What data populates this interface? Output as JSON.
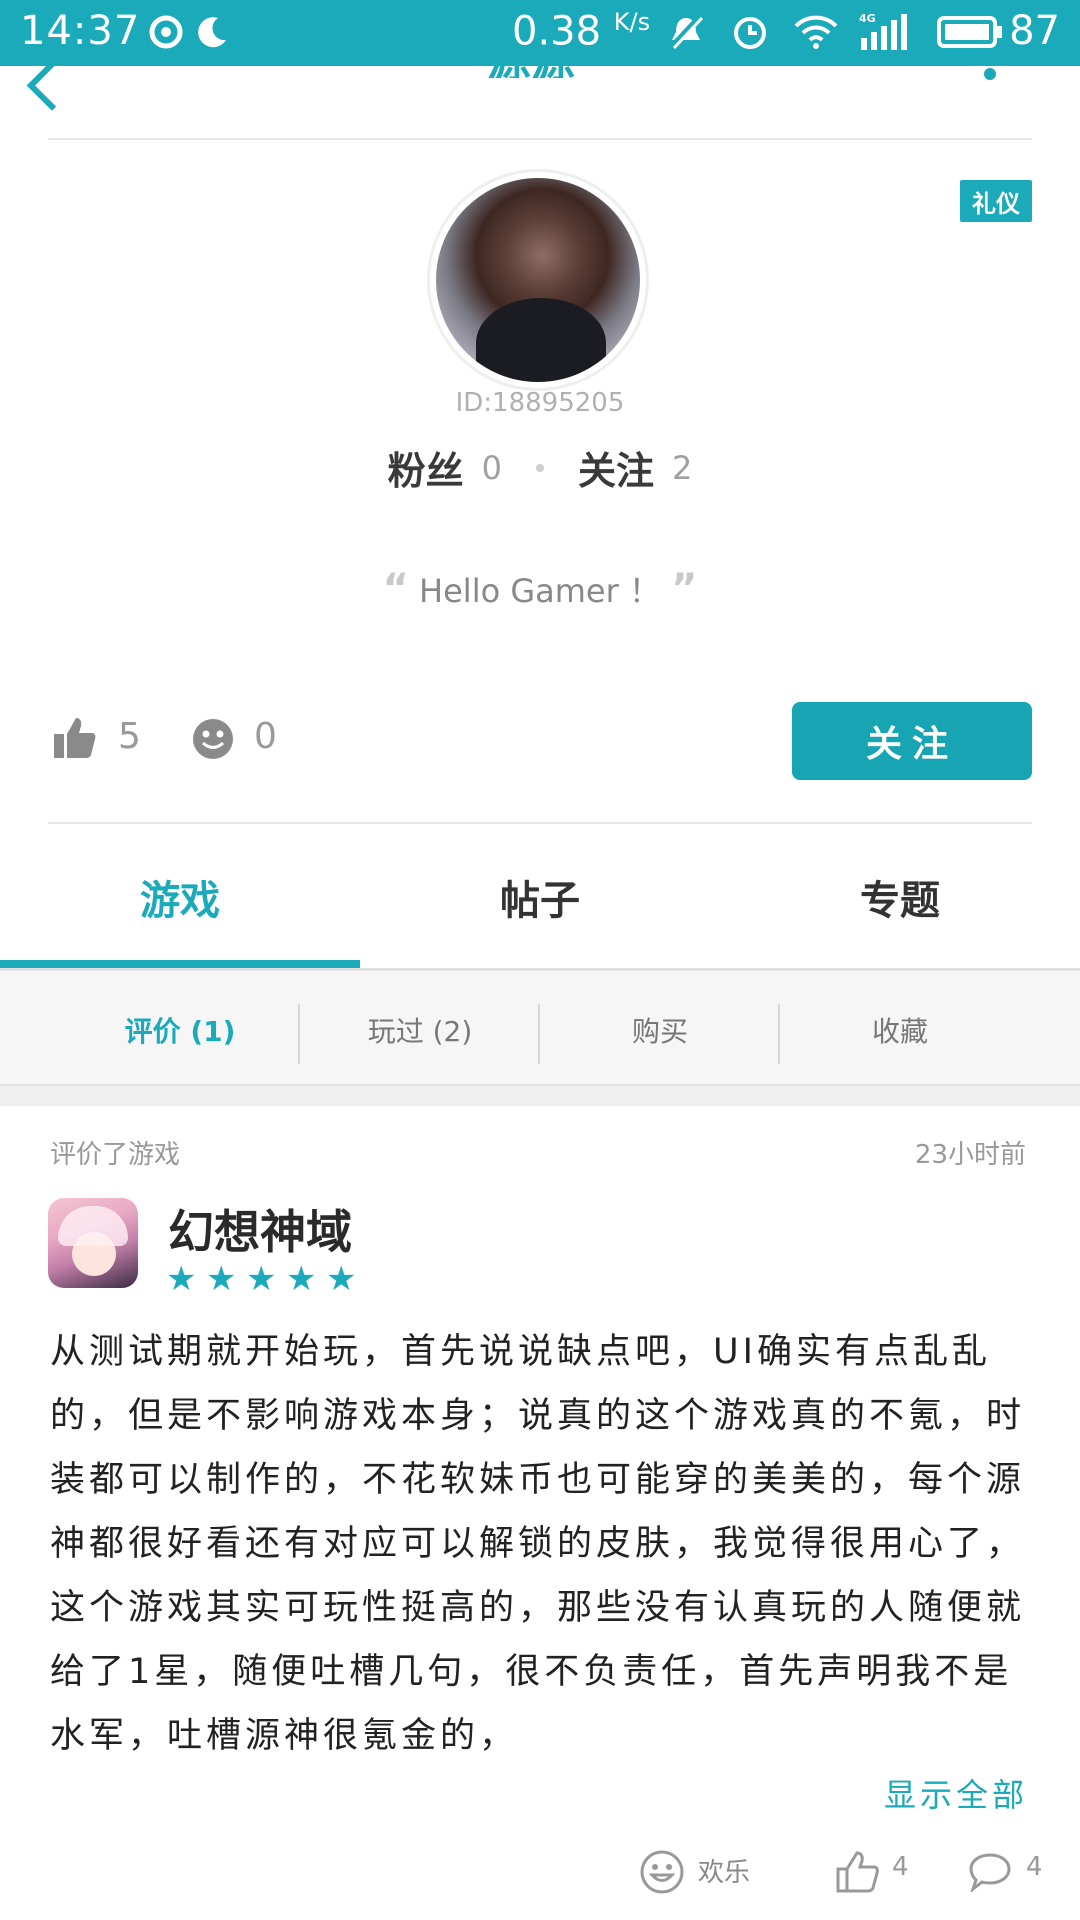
{
  "status_bar": {
    "time": "14:37",
    "net_speed": "0.38",
    "net_unit": "K/s",
    "network": "4G",
    "battery": "87"
  },
  "header": {
    "title": "·源源"
  },
  "profile": {
    "badge": "礼仪",
    "user_id": "ID:18895205",
    "fans_label": "粉丝",
    "fans_count": "0",
    "following_label": "关注",
    "following_count": "2",
    "signature": "Hello Gamer ！",
    "likes": "5",
    "smiles": "0",
    "follow_button": "关注"
  },
  "tabs": [
    {
      "label": "游戏",
      "active": true
    },
    {
      "label": "帖子",
      "active": false
    },
    {
      "label": "专题",
      "active": false
    }
  ],
  "subtabs": [
    {
      "label": "评价 (1)",
      "active": true
    },
    {
      "label": "玩过 (2)",
      "active": false
    },
    {
      "label": "购买",
      "active": false
    },
    {
      "label": "收藏",
      "active": false
    }
  ],
  "review": {
    "action": "评价了游戏",
    "time": "23小时前",
    "game_name": "幻想神域",
    "rating": 5,
    "text": "从测试期就开始玩，首先说说缺点吧，UI确实有点乱乱的，但是不影响游戏本身；说真的这个游戏真的不氪，时装都可以制作的，不花软妹币也可能穿的美美的，每个源神都很好看还有对应可以解锁的皮肤，我觉得很用心了，这个游戏其实可玩性挺高的，那些没有认真玩的人随便就给了1星，随便吐槽几句，很不负责任，首先声明我不是水军，吐槽源神很氪金的，",
    "show_all": "显示全部",
    "reaction_label": "欢乐",
    "like_count": "4",
    "comment_count": "4"
  },
  "colors": {
    "accent": "#1aaab9"
  }
}
